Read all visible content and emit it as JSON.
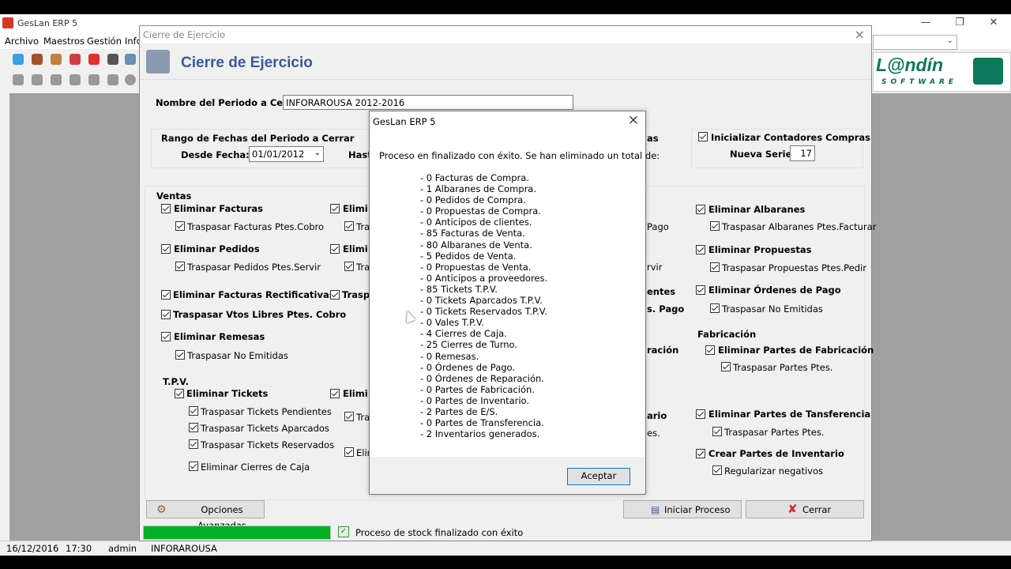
{
  "app": {
    "title": "GesLan ERP 5",
    "menu": [
      "Archivo",
      "Maestros",
      "Gestión",
      "Info"
    ],
    "logo_main": "L@ndín",
    "logo_sub": "SOFTWARE"
  },
  "statusbar": {
    "date": "16/12/2016",
    "time": "17:30",
    "user": "admin",
    "company": "INFORAROUSA"
  },
  "dialog": {
    "window_title": "Cierre de Ejercicio",
    "header_title": "Cierre de Ejercicio",
    "period_label": "Nombre del Periodo a Cerrar :",
    "period_value": "INFORAROUSA 2012-2016",
    "range_title": "Rango de Fechas del Periodo a Cerrar",
    "from_label": "Desde Fecha:",
    "from_value": "01/01/2012",
    "to_label": "Hast",
    "compras_trunc": "as",
    "init_compras_label": "Inicializar Contadores Compras",
    "new_series_label": "Nueva Serie:",
    "new_series_value": "17",
    "ventas_title": "Ventas",
    "col1": {
      "eliminar_facturas": "Eliminar Facturas",
      "traspasar_facturas": "Traspasar Facturas Ptes.Cobro",
      "eliminar_pedidos": "Eliminar Pedidos",
      "traspasar_pedidos": "Traspasar Pedidos Ptes.Servir",
      "eliminar_rectificativas": "Eliminar Facturas Rectificativas",
      "traspasar_vtos": "Traspasar Vtos Libres Ptes. Cobro",
      "eliminar_remesas": "Eliminar Remesas",
      "traspasar_no_emitidas": "Traspasar No Emitidas",
      "tpv_title": "T.P.V.",
      "eliminar_tickets": "Eliminar Tickets",
      "traspasar_tickets_pend": "Traspasar Tickets Pendientes",
      "traspasar_tickets_aparc": "Traspasar Tickets Aparcados",
      "traspasar_tickets_reserv": "Traspasar Tickets Reservados",
      "eliminar_cierres": "Eliminar Cierres de Caja"
    },
    "col2": {
      "a1": "Elimi",
      "a2": "Tra",
      "b1": "Elimi",
      "b2": "Tras",
      "c1": "Traspa",
      "d1": "Elimi",
      "d2": "Tras",
      "e1": "Elim"
    },
    "col3": {
      "a": "Pago",
      "b": "rvir",
      "c": "entes",
      "d": "s. Pago",
      "e": "ración",
      "f": "ario",
      "g": "es."
    },
    "col4": {
      "eliminar_albaranes": "Eliminar Albaranes",
      "traspasar_albaranes": "Traspasar Albaranes Ptes.Facturar",
      "eliminar_propuestas": "Eliminar Propuestas",
      "traspasar_propuestas": "Traspasar Propuestas Ptes.Pedir",
      "eliminar_ordenes": "Eliminar Órdenes de Pago",
      "traspasar_no_emitidas": "Traspasar No Emitidas",
      "fabricacion_title": "Fabricación",
      "eliminar_partes_fab": "Eliminar Partes de Fabricación",
      "traspasar_partes_ptes": "Traspasar Partes Ptes.",
      "eliminar_partes_transf": "Eliminar Partes de Tansferencia",
      "traspasar_partes_ptes2": "Traspasar Partes Ptes.",
      "crear_partes_inv": "Crear Partes de Inventario",
      "regularizar": "Regularizar negativos"
    },
    "btn_opciones": "Opciones Avanzadas",
    "btn_iniciar": "Iniciar Proceso",
    "btn_cerrar": "Cerrar",
    "progress_fraction": 1.0,
    "status_text": "Proceso de stock finalizado con éxito"
  },
  "msgbox": {
    "title": "GesLan ERP 5",
    "close": "×",
    "intro": "Proceso en finalizado con éxito. Se han eliminado un total de:",
    "items": [
      "- 0 Facturas de Compra.",
      "- 1 Albaranes de Compra.",
      "- 0 Pedidos de Compra.",
      "- 0 Propuestas de Compra.",
      "- 0 Anticipos de clientes.",
      "- 85 Facturas de Venta.",
      "- 80 Albaranes de Venta.",
      "- 5 Pedidos de Venta.",
      "- 0 Propuestas de Venta.",
      "- 0 Anticipos a proveedores.",
      "- 85 Tickets T.P.V.",
      "- 0 Tickets Aparcados T.P.V.",
      "- 0 Tickets Reservados T.P.V.",
      "- 0 Vales T.P.V.",
      "- 4 Cierres de Caja.",
      "- 25 Cierres de Turno.",
      "- 0 Remesas.",
      "- 0 Órdenes de Pago.",
      "- 0 Órdenes de Reparación.",
      "- 0 Partes de Fabricación.",
      "- 0 Partes de Inventario.",
      "- 2 Partes de E/S.",
      "- 0 Partes de Transferencia.",
      "- 2 Inventarios generados."
    ],
    "ok_label": "Aceptar"
  }
}
